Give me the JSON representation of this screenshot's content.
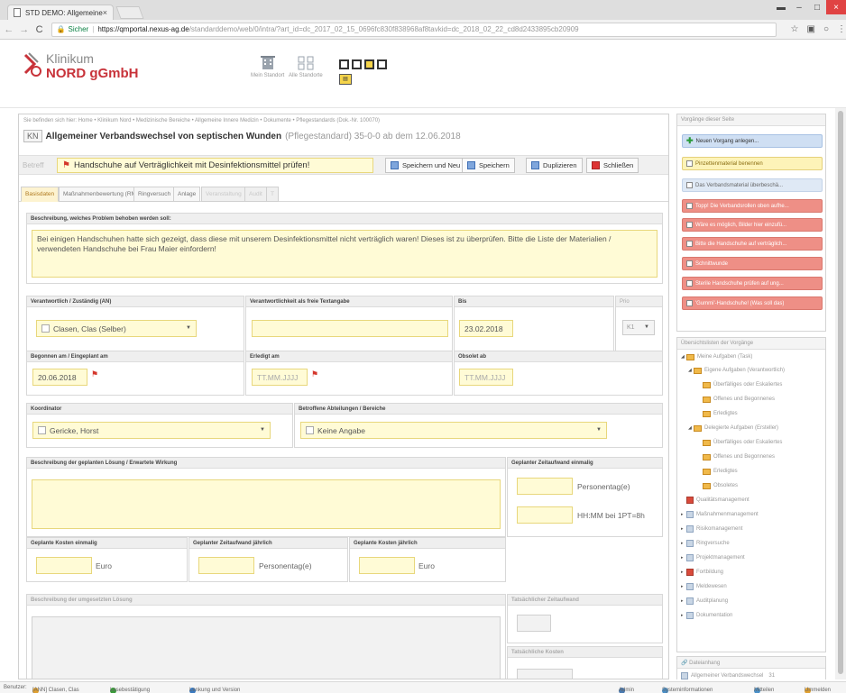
{
  "browser": {
    "tab_title": "STD DEMO: Allgemeiner",
    "tab_close": "×",
    "window_controls": [
      "▬",
      "–",
      "□",
      "×"
    ],
    "secure_label": "Sicher",
    "url_host": "https://qmportal.nexus-ag.de",
    "url_rest": "/standarddemo/web/0/intra/?art_id=dc_2017_02_15_0696fc830f838968af8tavkid=dc_2018_02_22_cd8d2433895cb20909"
  },
  "header": {
    "logo_line1": "Klinikum",
    "logo_line2": "NORD gGmbH",
    "btn_mein_standort": "Mein Standort",
    "btn_alle_standorte": "Alle Standorte"
  },
  "main": {
    "breadcrumb": "Sie befinden sich hier: Home • Klinikum Nord • Medizinische Bereiche • Allgemeine Innere Medizin • Dokumente • Pflegestandards (Dok.-Nr. 100070)",
    "kn": "KN",
    "doc_title": "Allgemeiner Verbandswechsel von septischen Wunden",
    "doc_subtitle": "(Pflegestandard)  35-0-0 ab dem 12.06.2018",
    "betreff_label": "Betreff",
    "betreff_flag": "⚑",
    "betreff_value": "Handschuhe auf Verträglichkeit mit Desinfektionsmittel prüfen!",
    "buttons": {
      "save_new": "Speichern und Neu",
      "save": "Speichern",
      "duplicate": "Duplizieren",
      "close": "Schließen"
    },
    "tabs": [
      "Basisdaten",
      "Maßnahmenbewertung (RM)",
      "Ringversuch",
      "Anlage",
      "Veranstaltung",
      "Audit",
      "T"
    ],
    "beschreibung_hdr": "Beschreibung, welches Problem behoben werden soll:",
    "beschreibung_text": "Bei einigen Handschuhen hatte sich gezeigt, dass diese mit unserem Desinfektionsmittel nicht verträglich waren! Dieses ist zu überprüfen. Bitte die Liste der Materialien / verwendeten Handschuhe bei Frau Maier einfordern!",
    "verantwortlich_hdr": "Verantwortlich / Zuständig (AN)",
    "verantwortlich_val": "Clasen, Clas (Selber)",
    "verantwortlich_frei_hdr": "Verantwortlichkeit als freie Textangabe",
    "bis_hdr": "Bis",
    "bis_val": "23.02.2018",
    "prio_hdr": "Prio",
    "prio_val": "K1",
    "begonnen_hdr": "Begonnen am / Eingeplant am",
    "begonnen_val": "20.06.2018",
    "erledigt_hdr": "Erledigt am",
    "erledigt_val": "TT.MM.JJJJ",
    "obsolet_hdr": "Obsolet ab",
    "obsolet_val": "TT.MM.JJJJ",
    "koordinator_hdr": "Koordinator",
    "koordinator_val": "Gericke, Horst",
    "abteilungen_hdr": "Betroffene Abteilungen / Bereiche",
    "abteilungen_val": "Keine Angabe",
    "loesung_hdr": "Beschreibung der geplanten Lösung / Erwartete Wirkung",
    "zeitaufwand_hdr": "Geplanter Zeitaufwand einmalig",
    "personentage": "Personentag(e)",
    "hhmm": "HH:MM bei 1PT=8h",
    "kosten_einmalig_hdr": "Geplante Kosten einmalig",
    "euro": "Euro",
    "zeitaufwand_jaehrlich_hdr": "Geplanter Zeitaufwand jährlich",
    "kosten_jaehrlich_hdr": "Geplante Kosten jährlich",
    "umgesetzt_hdr": "Beschreibung der umgesetzten Lösung",
    "tats_zeitaufwand_hdr": "Tatsächlicher Zeitaufwand",
    "tats_kosten_hdr": "Tatsächliche Kosten"
  },
  "sidebar": {
    "vorgaenge_hdr": "Vorgänge dieser Seite",
    "new_item": "Neuen Vorgang anlegen...",
    "items": [
      "Pinzettenmaterial benennen",
      "Das Verbandsmaterial überbeschä...",
      "Topp! Die Verbandsrollen oben aufhe...",
      "Wäre es möglich, Bilder hier einzufü...",
      "Bitte die Handschuhe auf verträglich...",
      "Schnittwunde",
      "Sterile Handschuhe prüfen auf ung...",
      "'Gummi'-Handschuhe! (Was soll das)"
    ],
    "uebersicht_hdr": "Übersichtslisten der Vorgänge",
    "tree": [
      "Meine Aufgaben (Task)",
      "Eigene Aufgaben (Verantwortlich)",
      "Überfälliges oder Eskaliertes",
      "Offenes und Begonnenes",
      "Erledigtes",
      "Delegierte Aufgaben (Ersteller)",
      "Überfälliges oder Eskaliertes",
      "Offenes und Begonnenes",
      "Erledigtes",
      "Obsoletes"
    ],
    "modules": [
      "Qualitätsmanagement",
      "Maßnahmenmanagement",
      "Risikomanagement",
      "Ringversuche",
      "Projektmanagement",
      "Fortbildung",
      "Meldewesen",
      "Auditplanung",
      "Dokumentation"
    ],
    "dateianhang_hdr": "Dateianhang",
    "attachment": "Allgemeiner Verbandswechsel",
    "attachment_num": "31"
  },
  "statusbar": {
    "benutzer": "Benutzer:",
    "user": "[ANN]  Clasen, Clas",
    "lesebestaetigung": "Lesebestätigung",
    "lenkung": "Lenkung und Version",
    "admin": "Admin",
    "systeminfo": "Systeminformationen",
    "mitteilen": "Mitteilen",
    "ummelden": "Ummelden"
  }
}
